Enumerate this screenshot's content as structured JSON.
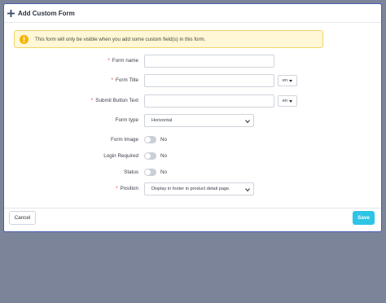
{
  "modal": {
    "title": "Add Custom Form",
    "alert": "This form will only be visible when you add some custom field(s) in this form."
  },
  "form": {
    "form_name": {
      "label": "Form name",
      "required": "*",
      "value": ""
    },
    "form_title": {
      "label": "Form Title",
      "required": "*",
      "value": "",
      "lang": "en"
    },
    "submit_button_text": {
      "label": "Submit Button Text",
      "required": "*",
      "value": "",
      "lang": "en"
    },
    "form_type": {
      "label": "Form type",
      "selected": "Horizontal"
    },
    "form_image": {
      "label": "Form Image",
      "toggle_text": "No"
    },
    "login_required": {
      "label": "Login Required",
      "toggle_text": "No"
    },
    "status": {
      "label": "Status",
      "toggle_text": "No"
    },
    "position": {
      "label": "Position",
      "required": "*",
      "selected": "Display in footer in product detail page."
    }
  },
  "footer": {
    "cancel_label": "Cancel",
    "save_label": "Save"
  },
  "colors": {
    "accent": "#2ec4e6",
    "modal_border": "#4b5db3",
    "alert_bg": "#fff7d6",
    "required": "#e53935",
    "backdrop": "#7c8499"
  },
  "icons": {
    "header": "plus-icon",
    "alert": "warning-icon",
    "dropdown": "chevron-down-icon"
  }
}
